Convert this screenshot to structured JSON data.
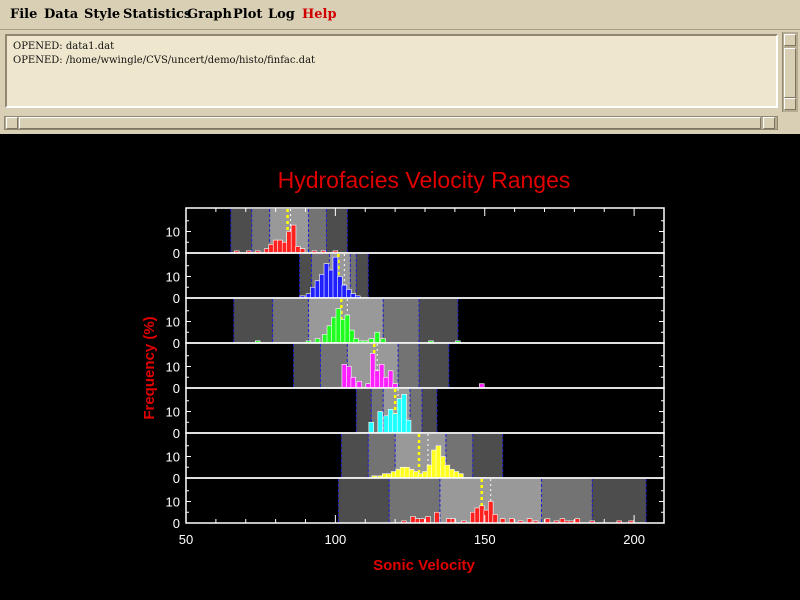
{
  "menubar": {
    "items": [
      {
        "id": "file",
        "label": "File"
      },
      {
        "id": "data",
        "label": "Data"
      },
      {
        "id": "style",
        "label": "Style"
      },
      {
        "id": "statistics",
        "label": "Statistics"
      },
      {
        "id": "graph",
        "label": "Graph"
      },
      {
        "id": "plot",
        "label": "Plot"
      },
      {
        "id": "log",
        "label": "Log"
      },
      {
        "id": "help",
        "label": "Help"
      }
    ]
  },
  "log": {
    "lines": [
      "OPENED: data1.dat",
      "OPENED: /home/wwingle/CVS/uncert/demo/histo/finfac.dat"
    ]
  },
  "colors": {
    "window_bg": "#d8cfb5",
    "plot_bg": "#000000",
    "title": "#e00000",
    "axes": "#ffffff",
    "mean_marker": "#ffff00",
    "range_edge": "#2020d0"
  },
  "chart_data": {
    "type": "bar",
    "title": "Hydrofacies Velocity Ranges",
    "xlabel": "Sonic Velocity",
    "ylabel": "Frequency (%)",
    "xlim": [
      50,
      210
    ],
    "xticks": [
      50,
      100,
      150,
      200
    ],
    "xtick_labels": [
      "50",
      "100",
      "150",
      "200"
    ],
    "yticks": [
      0,
      10
    ],
    "ytick_labels": [
      "0",
      "10"
    ],
    "panel_ylim": [
      0,
      20
    ],
    "bin_width": 1.6,
    "panels": [
      {
        "color": "#ff2020",
        "mean": 84,
        "median": 85,
        "ranges": [
          [
            65,
            72,
            0.3
          ],
          [
            72,
            78,
            0.45
          ],
          [
            78,
            91,
            0.6
          ],
          [
            91,
            97,
            0.45
          ],
          [
            97,
            104,
            0.3
          ]
        ],
        "x": [
          67,
          71,
          74,
          77,
          78.5,
          80,
          81.5,
          83,
          84.5,
          86,
          87.5,
          89,
          93,
          96,
          100
        ],
        "values": [
          1,
          1,
          1,
          2,
          4,
          6,
          6,
          5,
          10,
          13,
          3,
          2,
          1,
          1,
          1
        ]
      },
      {
        "color": "#2020ff",
        "mean": 101,
        "median": 103,
        "ranges": [
          [
            88,
            92,
            0.3
          ],
          [
            92,
            98,
            0.45
          ],
          [
            98,
            105,
            0.6
          ],
          [
            105,
            107,
            0.45
          ],
          [
            107,
            111,
            0.3
          ]
        ],
        "x": [
          89,
          91,
          92.5,
          94,
          95.5,
          97,
          98.5,
          100,
          101.5,
          103,
          104.5,
          106,
          107.5
        ],
        "values": [
          1,
          2,
          5,
          8,
          11,
          16,
          13,
          19,
          10,
          6,
          4,
          2,
          1
        ]
      },
      {
        "color": "#20ff20",
        "mean": 102,
        "median": 104,
        "ranges": [
          [
            66,
            79,
            0.3
          ],
          [
            79,
            91,
            0.45
          ],
          [
            91,
            116,
            0.6
          ],
          [
            116,
            128,
            0.45
          ],
          [
            128,
            141,
            0.3
          ]
        ],
        "x": [
          74,
          91,
          94,
          96.5,
          98,
          99.5,
          101,
          102.5,
          104,
          105.5,
          107,
          108.5,
          110,
          112,
          114,
          116,
          132,
          141
        ],
        "values": [
          1,
          1,
          2,
          4,
          8,
          12,
          16,
          11,
          13,
          6,
          2,
          1,
          1,
          2,
          5,
          2,
          1,
          1
        ]
      },
      {
        "color": "#ff20ff",
        "mean": 113,
        "median": 114,
        "ranges": [
          [
            86,
            95,
            0.3
          ],
          [
            95,
            104,
            0.45
          ],
          [
            104,
            121,
            0.6
          ],
          [
            121,
            128,
            0.45
          ],
          [
            128,
            138,
            0.3
          ]
        ],
        "x": [
          103,
          104.5,
          106,
          108,
          111,
          112.5,
          114,
          115.5,
          117,
          118.5,
          120,
          149
        ],
        "values": [
          11,
          10,
          5,
          3,
          2,
          16,
          8,
          11,
          5,
          8,
          2,
          2
        ]
      },
      {
        "color": "#20ffff",
        "mean": 120,
        "median": 121,
        "ranges": [
          [
            107,
            112,
            0.3
          ],
          [
            112,
            116,
            0.45
          ],
          [
            116,
            125,
            0.6
          ],
          [
            125,
            129,
            0.45
          ],
          [
            129,
            134,
            0.3
          ]
        ],
        "x": [
          112,
          115,
          117,
          118.5,
          120,
          121.5,
          123,
          124.5
        ],
        "values": [
          5,
          10,
          8,
          11,
          9,
          16,
          18,
          6
        ]
      },
      {
        "color": "#ffff20",
        "mean": 128,
        "median": 131,
        "ranges": [
          [
            102,
            111,
            0.3
          ],
          [
            111,
            120,
            0.45
          ],
          [
            120,
            137,
            0.6
          ],
          [
            137,
            146,
            0.45
          ],
          [
            146,
            156,
            0.3
          ]
        ],
        "x": [
          113,
          115,
          116.5,
          118,
          119.5,
          121,
          122.5,
          124,
          125.5,
          127,
          128.5,
          130,
          131.5,
          133,
          134.5,
          136,
          137.5,
          139,
          140.5,
          142
        ],
        "values": [
          1,
          1,
          2,
          2,
          3,
          4,
          5,
          5,
          4,
          3,
          2,
          3,
          6,
          13,
          15,
          10,
          6,
          4,
          3,
          2
        ]
      },
      {
        "color": "#ff2020",
        "mean": 149,
        "median": 152,
        "ranges": [
          [
            101,
            118,
            0.3
          ],
          [
            118,
            135,
            0.45
          ],
          [
            135,
            169,
            0.6
          ],
          [
            169,
            186,
            0.45
          ],
          [
            186,
            204,
            0.3
          ]
        ],
        "x": [
          123,
          126,
          127.5,
          129,
          131,
          134,
          138,
          139.5,
          143,
          146,
          147.5,
          149,
          150.5,
          152,
          153.5,
          156,
          159,
          162,
          165,
          167,
          171,
          174,
          176,
          177.5,
          179,
          181,
          186,
          195,
          199
        ],
        "values": [
          1,
          3,
          2,
          2,
          3,
          5,
          2,
          2,
          1,
          5,
          7,
          8,
          6,
          10,
          4,
          2,
          2,
          1,
          2,
          1,
          2,
          1,
          2,
          1,
          1,
          2,
          1,
          1,
          1
        ]
      }
    ]
  }
}
